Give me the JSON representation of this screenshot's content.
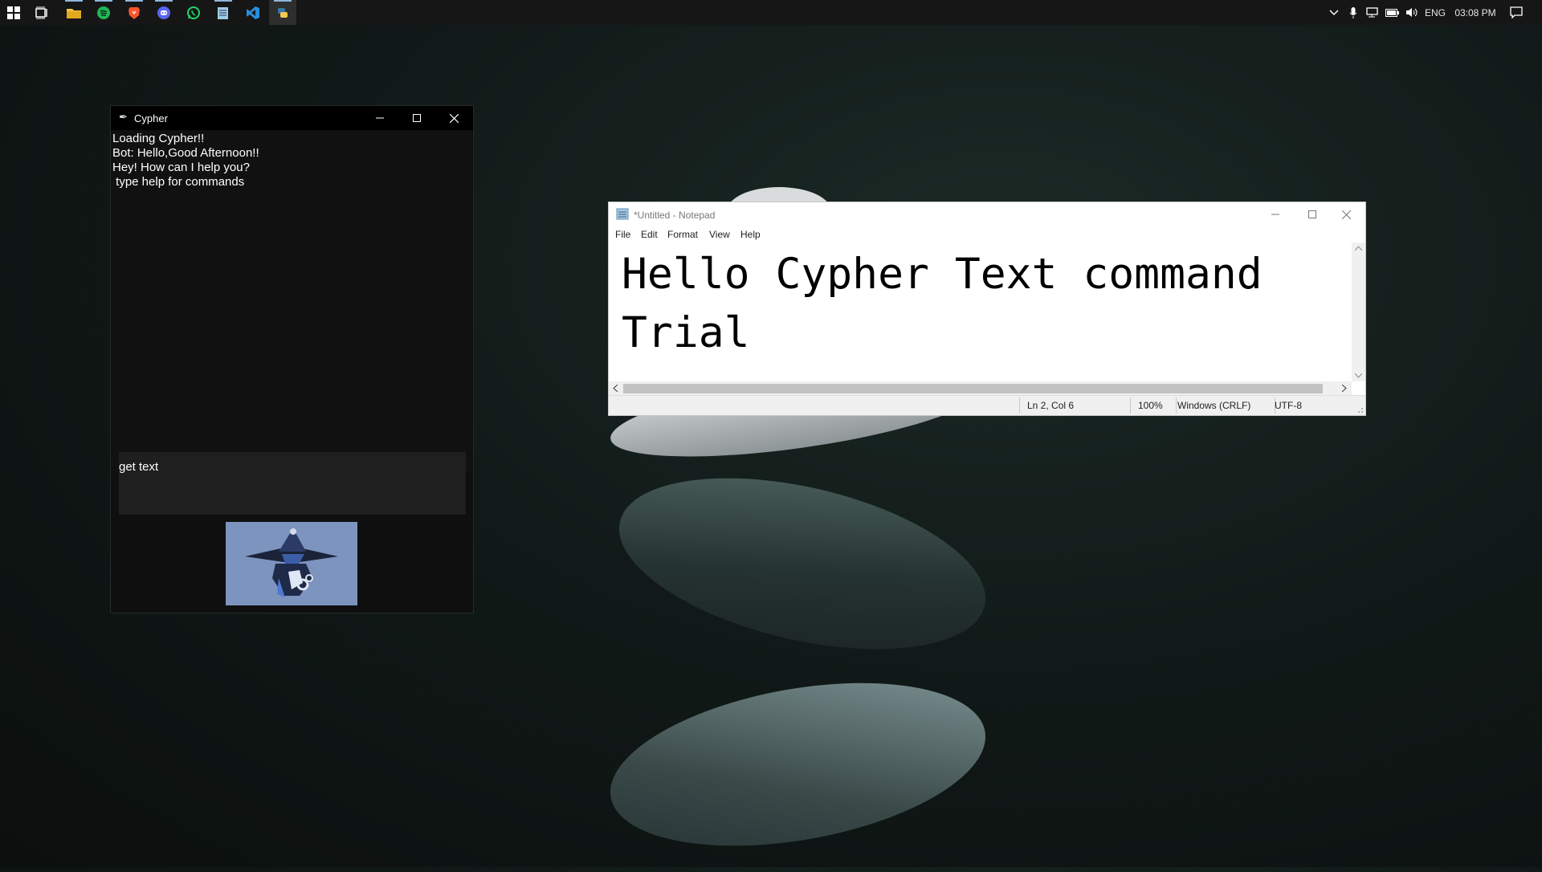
{
  "taskbar": {
    "apps": [
      {
        "name": "File Explorer",
        "icon": "folder-icon",
        "color": "#f3c33b"
      },
      {
        "name": "Spotify",
        "icon": "spotify-icon",
        "color": "#1db954"
      },
      {
        "name": "Brave",
        "icon": "brave-icon",
        "color": "#fb542b"
      },
      {
        "name": "Discord",
        "icon": "discord-icon",
        "color": "#5865f2"
      },
      {
        "name": "WhatsApp",
        "icon": "whatsapp-icon",
        "color": "#25d366"
      },
      {
        "name": "Notepad",
        "icon": "notepad-icon",
        "color": "#9ecbe6"
      },
      {
        "name": "Visual Studio Code",
        "icon": "vscode-icon",
        "color": "#2a8ddb"
      },
      {
        "name": "Python",
        "icon": "python-icon",
        "color": "#f2c94c"
      }
    ],
    "tray": {
      "language": "ENG",
      "time": "03:08 PM"
    }
  },
  "cypher": {
    "title": "Cypher",
    "log": [
      "Loading Cypher!!",
      "Bot: Hello,Good Afternoon!!",
      "Hey! How can I help you?",
      " type help for commands"
    ],
    "input_value": "get text",
    "avatar_icon": "wizard-avatar-icon"
  },
  "notepad": {
    "title": "*Untitled - Notepad",
    "menu": [
      "File",
      "Edit",
      "Format",
      "View",
      "Help"
    ],
    "content_lines": [
      "Hello Cypher Text command",
      "Trial"
    ],
    "status": {
      "position": "Ln 2, Col 6",
      "zoom": "100%",
      "line_ending": "Windows (CRLF)",
      "encoding": "UTF-8"
    }
  }
}
